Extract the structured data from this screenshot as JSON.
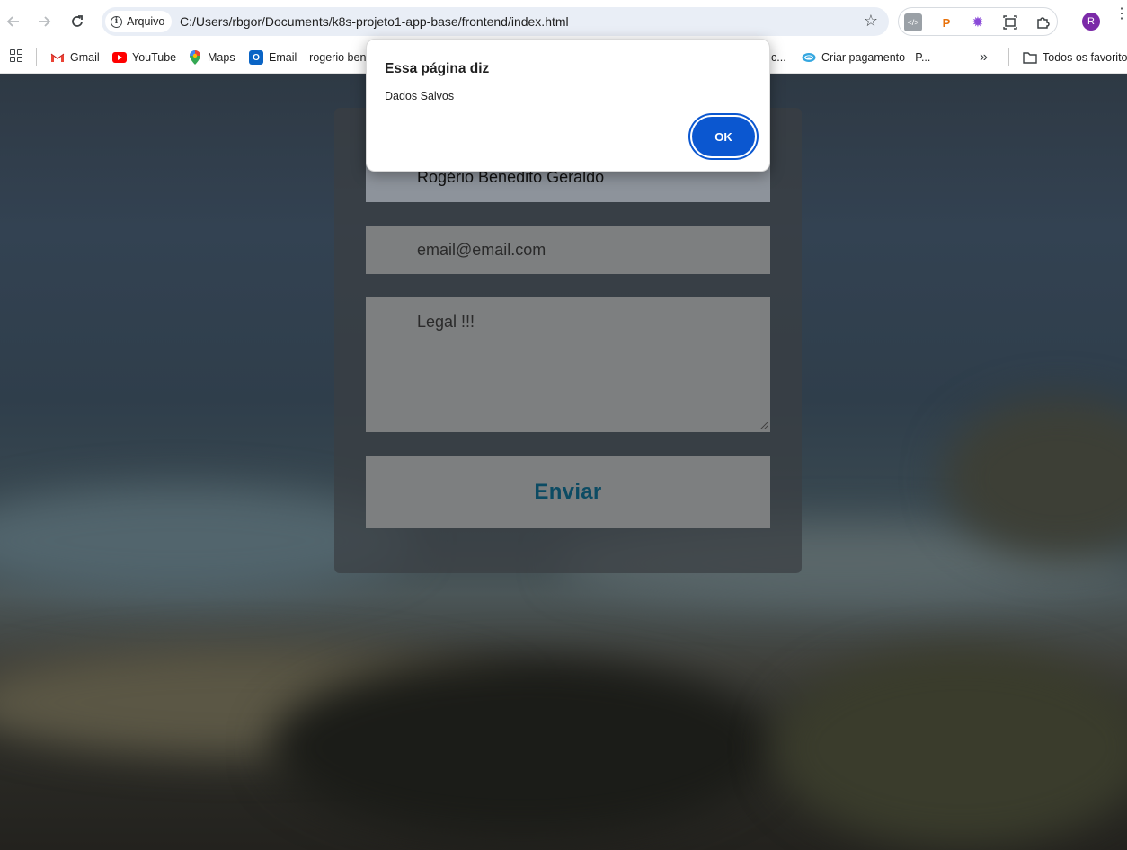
{
  "browser": {
    "site_chip_label": "Arquivo",
    "url": "C:/Users/rbgor/Documents/k8s-projeto1-app-base/frontend/index.html",
    "avatar_initial": "R"
  },
  "bookmarks": {
    "items": [
      {
        "label": "Gmail",
        "icon": "gmail-icon"
      },
      {
        "label": "YouTube",
        "icon": "youtube-icon"
      },
      {
        "label": "Maps",
        "icon": "maps-icon"
      },
      {
        "label": "Email – rogerio ben...",
        "icon": "outlook-icon"
      },
      {
        "label": "c...",
        "icon": ""
      },
      {
        "label": "Criar pagamento - P...",
        "icon": "payment-icon"
      }
    ],
    "overflow_label": "»",
    "all_bookmarks_label": "Todos os favoritos"
  },
  "form": {
    "name_value": "Rogério Benedito Geraldo",
    "email_value": "email@email.com",
    "message_value": "Legal !!!",
    "submit_label": "Enviar"
  },
  "alert": {
    "title": "Essa página diz",
    "message": "Dados Salvos",
    "ok_label": "OK"
  },
  "colors": {
    "primary": "#0b57d0",
    "submit_text": "#0c4b63"
  }
}
